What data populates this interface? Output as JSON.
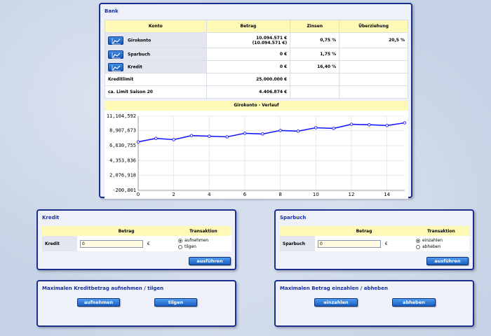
{
  "bank": {
    "title": "Bank",
    "headers": {
      "konto": "Konto",
      "betrag": "Betrag",
      "zinsen": "Zinsen",
      "ueberziehung": "Überziehung"
    },
    "rows": [
      {
        "name": "Girokonto",
        "betrag1": "10.094.571 €",
        "betrag2": "(10.094.571 €)",
        "zinsen": "0,75 %",
        "ueberziehung": "20,5 %"
      },
      {
        "name": "Sparbuch",
        "betrag1": "0 €",
        "zinsen": "1,75 %",
        "ueberziehung": ""
      },
      {
        "name": "Kredit",
        "betrag1": "0 €",
        "zinsen": "16,40 %",
        "ueberziehung": ""
      }
    ],
    "kreditlimit_label": "Kreditlimit",
    "kreditlimit_value": "25.000.000 €",
    "limit_saison_label": "ca. Limit Saison 20",
    "limit_saison_value": "4.406.874 €",
    "chart_header": "Girokonto - Verlauf"
  },
  "chart_data": {
    "type": "line",
    "x": [
      0,
      1,
      2,
      3,
      4,
      5,
      6,
      7,
      8,
      9,
      10,
      11,
      12,
      13,
      14,
      15
    ],
    "y": [
      7190000,
      7720000,
      7530000,
      8150000,
      8050000,
      7960000,
      8500000,
      8400000,
      8930000,
      8830000,
      9350000,
      9250000,
      9870000,
      9800000,
      9690000,
      10094571
    ],
    "yticks": [
      "11,104,592",
      "8,907,673",
      "6,630,755",
      "4,353,836",
      "2,076,918",
      "-200,001"
    ],
    "ytick_values": [
      11104592,
      8907673,
      6630755,
      4353836,
      2076918,
      -200001
    ],
    "xticks": [
      0,
      2,
      4,
      6,
      8,
      10,
      12,
      14
    ],
    "ylim": [
      -200001,
      11104592
    ],
    "xlim": [
      0,
      15
    ],
    "color": "#1a1aff",
    "grid": true
  },
  "kredit": {
    "title": "Kredit",
    "col_betrag": "Betrag",
    "col_transaktion": "Transaktion",
    "row_label": "Kredit",
    "input_value": "0",
    "currency": "€",
    "opt1": "aufnehmen",
    "opt2": "tilgen",
    "submit": "ausführen"
  },
  "sparbuch": {
    "title": "Sparbuch",
    "col_betrag": "Betrag",
    "col_transaktion": "Transaktion",
    "row_label": "Sparbuch",
    "input_value": "0",
    "currency": "€",
    "opt1": "einzahlen",
    "opt2": "abheben",
    "submit": "ausführen"
  },
  "max_kredit": {
    "title": "Maximalen Kreditbetrag aufnehmen / tilgen",
    "btn1": "aufnehmen",
    "btn2": "tilgen"
  },
  "max_spar": {
    "title": "Maximalen Betrag einzahlen / abheben",
    "btn1": "einzahlen",
    "btn2": "abheben"
  }
}
